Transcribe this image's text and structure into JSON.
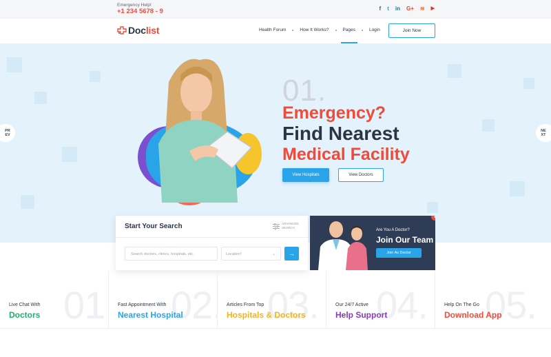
{
  "topbar": {
    "emergency_label": "Emergency Help!",
    "emergency_phone": "+1 234 5678 - 9",
    "socials": [
      {
        "icon": "facebook-icon",
        "glyph": "f",
        "color": "#3b5998"
      },
      {
        "icon": "twitter-icon",
        "glyph": "t",
        "color": "#1da1f2"
      },
      {
        "icon": "linkedin-icon",
        "glyph": "in",
        "color": "#0077b5"
      },
      {
        "icon": "google-plus-icon",
        "glyph": "G+",
        "color": "#dd4b39"
      },
      {
        "icon": "rss-icon",
        "glyph": "≋",
        "color": "#f26522"
      },
      {
        "icon": "youtube-icon",
        "glyph": "▶",
        "color": "#e52d27"
      }
    ]
  },
  "nav": {
    "logo_doc": "Doc",
    "logo_list": "list",
    "items": [
      "Health Forum",
      "How It Works?",
      "Pages",
      "Login"
    ],
    "active_item": "Pages",
    "join_label": "Join Now"
  },
  "hero": {
    "prev_label": "PR\nEV",
    "next_label": "NE\nXT",
    "slide_number": "01.",
    "line1": "Emergency?",
    "line2": "Find Nearest",
    "line3": "Medical Facility",
    "btn_hospitals": "View Hospitals",
    "btn_doctors": "View Doctors"
  },
  "search": {
    "title": "Start Your Search",
    "advanced_line1": "ADVANCED",
    "advanced_line2": "SEARCH",
    "input_placeholder": "Search doctors, clinics, hospitals, etc.",
    "location_label": "Location*",
    "go_glyph": "→"
  },
  "doctor_promo": {
    "question": "Are You A Doctor?",
    "title": "Join Our Team",
    "button": "Join As Doctor"
  },
  "features": [
    {
      "number": "01.",
      "small": "Live Chat With",
      "bold": "Doctors",
      "color": "#19b26b"
    },
    {
      "number": "02.",
      "small": "Fast Appointment With",
      "bold": "Nearest Hospital",
      "color": "#2aa4e8"
    },
    {
      "number": "03.",
      "small": "Articles From Top",
      "bold": "Hospitals & Doctors",
      "color": "#f5b21b"
    },
    {
      "number": "04.",
      "small": "Our 24/7 Active",
      "bold": "Help Support",
      "color": "#8a3ab9"
    },
    {
      "number": "05.",
      "small": "Help On The Go",
      "bold": "Download App",
      "color": "#ef4b3a"
    }
  ],
  "colors": {
    "accent": "#2aa4e8",
    "brand_red": "#ef4b3a",
    "dark": "#2b3445"
  }
}
